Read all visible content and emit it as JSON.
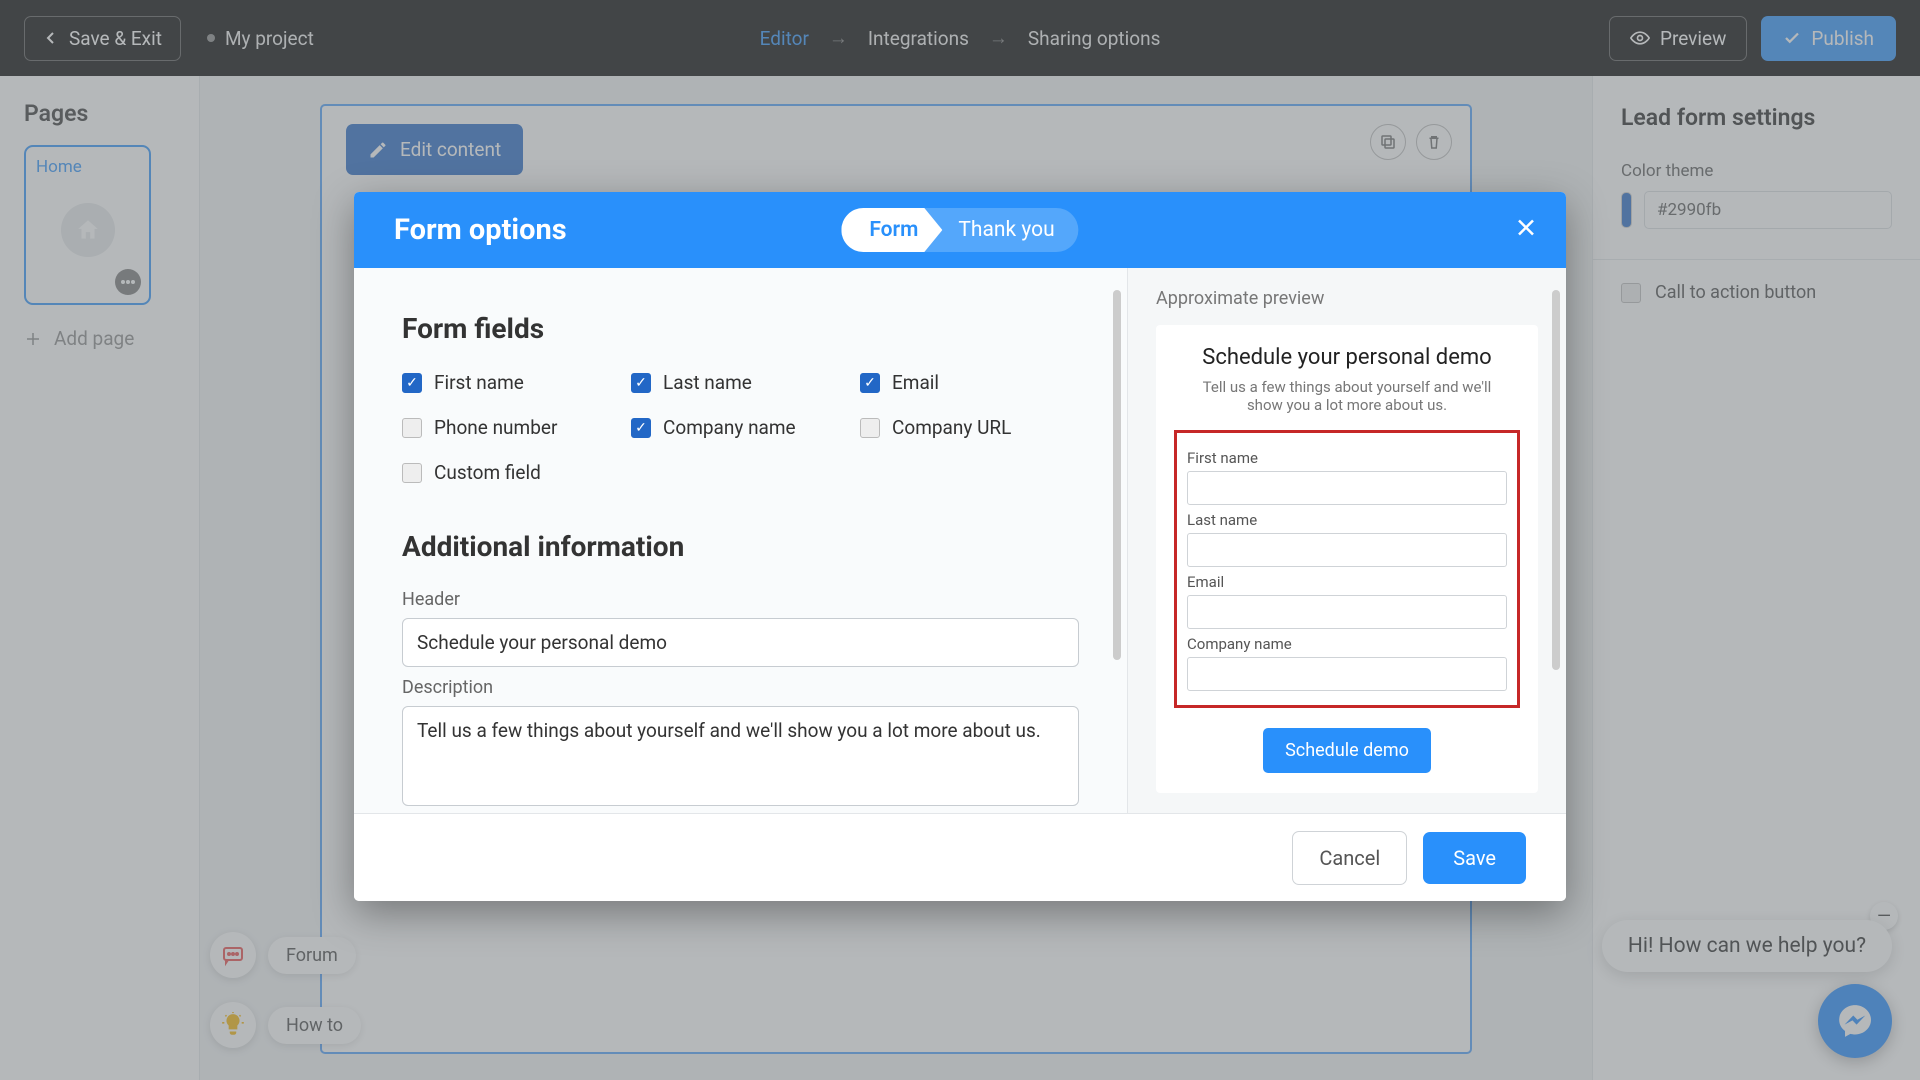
{
  "topbar": {
    "save_exit": "Save & Exit",
    "project": "My project",
    "steps": {
      "editor": "Editor",
      "integrations": "Integrations",
      "sharing": "Sharing options"
    },
    "preview": "Preview",
    "publish": "Publish"
  },
  "pages": {
    "title": "Pages",
    "home": "Home",
    "add": "Add page"
  },
  "settings": {
    "title": "Lead form settings",
    "color_label": "Color theme",
    "color_value": "#2990fb",
    "cta": "Call to action button"
  },
  "canvas": {
    "edit_content": "Edit content",
    "block_title": "Schedule your personal demo"
  },
  "help": {
    "forum": "Forum",
    "howto": "How to"
  },
  "chat": {
    "bubble": "Hi! How can we help you?"
  },
  "modal": {
    "title": "Form options",
    "tabs": {
      "form": "Form",
      "thank": "Thank you"
    },
    "section_fields": "Form fields",
    "fields": {
      "first_name": {
        "label": "First name",
        "checked": true
      },
      "last_name": {
        "label": "Last name",
        "checked": true
      },
      "email": {
        "label": "Email",
        "checked": true
      },
      "phone": {
        "label": "Phone number",
        "checked": false
      },
      "company": {
        "label": "Company name",
        "checked": true
      },
      "url": {
        "label": "Company URL",
        "checked": false
      },
      "custom": {
        "label": "Custom field",
        "checked": false
      }
    },
    "section_additional": "Additional information",
    "header_label": "Header",
    "header_value": "Schedule your personal demo",
    "desc_label": "Description",
    "desc_value": "Tell us a few things about yourself and we'll show you a lot more about us.",
    "preview_label": "Approximate preview",
    "preview": {
      "title": "Schedule your personal demo",
      "sub": "Tell us a few things about yourself and we'll show you a lot more about us.",
      "fields": [
        "First name",
        "Last name",
        "Email",
        "Company name"
      ],
      "submit": "Schedule demo"
    },
    "cancel": "Cancel",
    "save": "Save"
  }
}
